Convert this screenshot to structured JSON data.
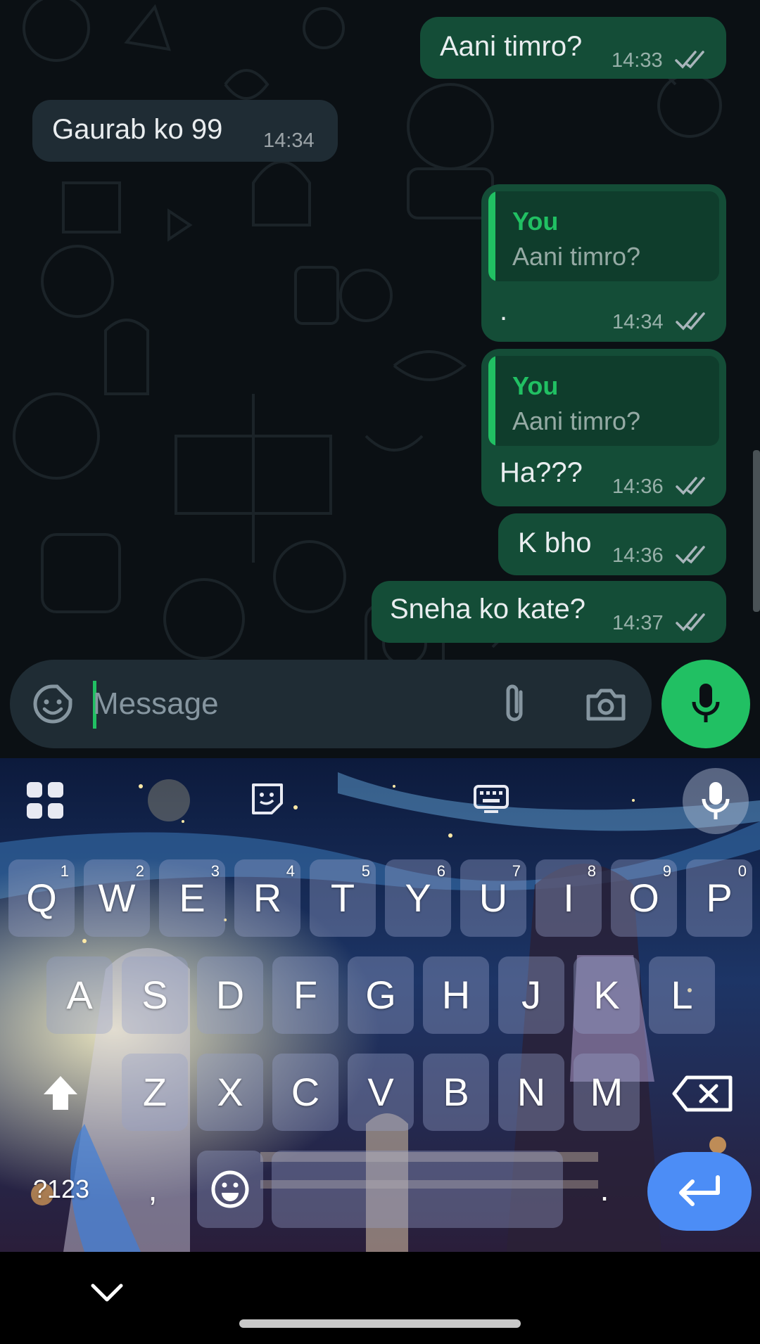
{
  "chat": {
    "messages": [
      {
        "dir": "out",
        "text": "Aani timro?",
        "time": "14:33",
        "status": "read"
      },
      {
        "dir": "in",
        "text": "Gaurab ko 99",
        "time": "14:34"
      },
      {
        "dir": "out",
        "quote_author": "You",
        "quote_text": "Aani timro?",
        "text": ".",
        "time": "14:34",
        "status": "read"
      },
      {
        "dir": "out",
        "quote_author": "You",
        "quote_text": "Aani timro?",
        "text": "Ha???",
        "time": "14:36",
        "status": "read"
      },
      {
        "dir": "out",
        "text": "K bho",
        "time": "14:36",
        "status": "read"
      },
      {
        "dir": "out",
        "text": "Sneha ko kate?",
        "time": "14:37",
        "status": "read"
      }
    ]
  },
  "composer": {
    "placeholder": "Message",
    "value": "",
    "icons": [
      "sticker-icon",
      "paperclip-icon",
      "camera-icon",
      "microphone-icon"
    ]
  },
  "keyboard": {
    "toolbar_icons": [
      "apps-grid-icon",
      "sticker-icon",
      "keyboard-icon",
      "microphone-icon"
    ],
    "row1": [
      {
        "label": "Q",
        "hint": "1"
      },
      {
        "label": "W",
        "hint": "2"
      },
      {
        "label": "E",
        "hint": "3"
      },
      {
        "label": "R",
        "hint": "4"
      },
      {
        "label": "T",
        "hint": "5"
      },
      {
        "label": "Y",
        "hint": "6"
      },
      {
        "label": "U",
        "hint": "7"
      },
      {
        "label": "I",
        "hint": "8"
      },
      {
        "label": "O",
        "hint": "9"
      },
      {
        "label": "P",
        "hint": "0"
      }
    ],
    "row2": [
      "A",
      "S",
      "D",
      "F",
      "G",
      "H",
      "J",
      "K",
      "L"
    ],
    "row3": [
      "Z",
      "X",
      "C",
      "V",
      "B",
      "N",
      "M"
    ],
    "symbols_label": "?123",
    "comma_label": ",",
    "period_label": ".",
    "special_icons": [
      "shift-icon",
      "backspace-icon",
      "emoji-icon",
      "enter-icon"
    ]
  },
  "nav": {
    "icons": [
      "keyboard-hide-chevron-icon"
    ]
  },
  "colors": {
    "chat_bg": "#0b1014",
    "outgoing_bubble": "#144d37",
    "incoming_bubble": "#1f2c34",
    "accent_green": "#21c063",
    "enter_key": "#4c8df6"
  }
}
